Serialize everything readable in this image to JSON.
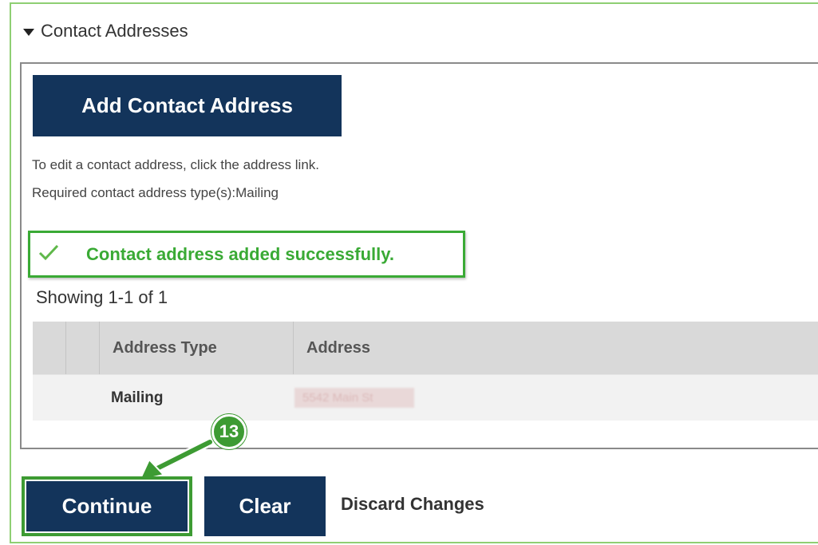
{
  "section": {
    "title": "Contact Addresses"
  },
  "add_button_label": "Add Contact Address",
  "help": {
    "line1": "To edit a contact address, click the address link.",
    "line2": "Required contact address type(s):Mailing"
  },
  "success_message": "Contact address added successfully.",
  "showing_text": "Showing 1-1 of 1",
  "table": {
    "headers": [
      "Address Type",
      "Address"
    ],
    "rows": [
      {
        "address_type": "Mailing",
        "address": "5542 Main St"
      }
    ]
  },
  "annotation": {
    "step_number": "13"
  },
  "actions": {
    "continue_label": "Continue",
    "clear_label": "Clear",
    "discard_label": "Discard Changes"
  },
  "colors": {
    "primary_button": "#13345b",
    "success_green": "#3aaa35",
    "annotation_green": "#3d9b33",
    "header_gray": "#d9d9d9"
  }
}
